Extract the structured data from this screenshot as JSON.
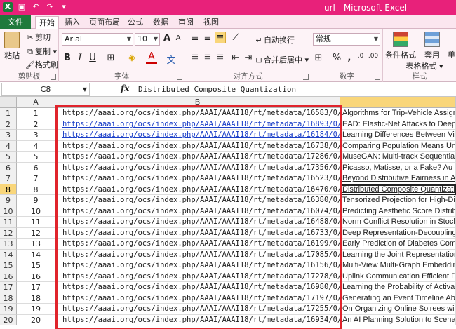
{
  "app": {
    "title": "url - Microsoft Excel",
    "qat": [
      "save-icon",
      "undo-icon",
      "redo-icon"
    ]
  },
  "tabs": [
    "文件",
    "开始",
    "插入",
    "页面布局",
    "公式",
    "数据",
    "审阅",
    "视图"
  ],
  "ribbon": {
    "clipboard": {
      "paste": "粘贴",
      "cut": "剪切",
      "copy": "复制 ▾",
      "format_painter": "格式刷",
      "label": "剪贴板"
    },
    "font": {
      "name": "Arial",
      "size": "10",
      "bold": "B",
      "italic": "I",
      "underline": "U",
      "label": "字体",
      "grow": "A",
      "shrink": "A",
      "phonetic": "文"
    },
    "alignment": {
      "wrap": "自动换行",
      "merge": "合并后居中 ▾",
      "label": "对齐方式"
    },
    "number": {
      "format": "常规",
      "percent": "%",
      "comma": ",",
      "label": "数字"
    },
    "styles": {
      "conditional": "条件格式",
      "table": "套用",
      "table2": "表格格式 ▾",
      "cell": "单",
      "label": "样式"
    }
  },
  "formula_bar": {
    "name_box": "C8",
    "fx": "fx",
    "content": "Distributed Composite Quantization"
  },
  "grid": {
    "columns": [
      "A",
      "B"
    ],
    "selected_row": 8,
    "rows": [
      {
        "n": "1",
        "a": "1",
        "b": "https://aaai.org/ocs/index.php/AAAI/AAAI18/rt/metadata/16583/0/",
        "c": "Algorithms for Trip-Vehicle Assign"
      },
      {
        "n": "2",
        "a": "2",
        "b": "https://aaai.org/ocs/index.php/AAAI/AAAI18/rt/metadata/16893/0/",
        "c": "EAD: Elastic-Net Attacks to Deep"
      },
      {
        "n": "3",
        "a": "3",
        "b": "https://aaai.org/ocs/index.php/AAAI/AAAI18/rt/metadata/16184/0/",
        "c": "Learning Differences Between Vis"
      },
      {
        "n": "4",
        "a": "4",
        "b": "https://aaai.org/ocs/index.php/AAAI/AAAI18/rt/metadata/16738/0/",
        "c": "Comparing Population Means Und"
      },
      {
        "n": "5",
        "a": "5",
        "b": "https://aaai.org/ocs/index.php/AAAI/AAAI18/rt/metadata/17286/0/",
        "c": "MuseGAN: Multi-track Sequential"
      },
      {
        "n": "6",
        "a": "6",
        "b": "https://aaai.org/ocs/index.php/AAAI/AAAI18/rt/metadata/17356/0/",
        "c": "Picasso, Matisse, or a Fake?  Au"
      },
      {
        "n": "7",
        "a": "7",
        "b": "https://aaai.org/ocs/index.php/AAAI/AAAI18/rt/metadata/16523/0/",
        "c": "Beyond Distributive Fairness in Al"
      },
      {
        "n": "8",
        "a": "8",
        "b": "https://aaai.org/ocs/index.php/AAAI/AAAI18/rt/metadata/16470/0/",
        "c": "Distributed Composite Quantizatio"
      },
      {
        "n": "9",
        "a": "9",
        "b": "https://aaai.org/ocs/index.php/AAAI/AAAI18/rt/metadata/16380/0/",
        "c": "Tensorized Projection for High-Dir"
      },
      {
        "n": "10",
        "a": "10",
        "b": "https://aaai.org/ocs/index.php/AAAI/AAAI18/rt/metadata/16074/0/",
        "c": "Predicting Aesthetic Score Distrib"
      },
      {
        "n": "11",
        "a": "11",
        "b": "https://aaai.org/ocs/index.php/AAAI/AAAI18/rt/metadata/16488/0/",
        "c": "Norm Conflict Resolution in Stoch"
      },
      {
        "n": "12",
        "a": "12",
        "b": "https://aaai.org/ocs/index.php/AAAI/AAAI18/rt/metadata/16733/0/",
        "c": "Deep Representation-Decoupling"
      },
      {
        "n": "13",
        "a": "13",
        "b": "https://aaai.org/ocs/index.php/AAAI/AAAI18/rt/metadata/16199/0/",
        "c": "Early Prediction of Diabetes Comp"
      },
      {
        "n": "14",
        "a": "14",
        "b": "https://aaai.org/ocs/index.php/AAAI/AAAI18/rt/metadata/17085/0/",
        "c": "Learning the Joint Representation"
      },
      {
        "n": "15",
        "a": "15",
        "b": "https://aaai.org/ocs/index.php/AAAI/AAAI18/rt/metadata/16156/0/",
        "c": "Multi-View Multi-Graph Embeddin"
      },
      {
        "n": "16",
        "a": "16",
        "b": "https://aaai.org/ocs/index.php/AAAI/AAAI18/rt/metadata/17278/0/",
        "c": "Uplink Communication Efficient Di"
      },
      {
        "n": "17",
        "a": "17",
        "b": "https://aaai.org/ocs/index.php/AAAI/AAAI18/rt/metadata/16980/0/",
        "c": "Learning the Probability of Activat"
      },
      {
        "n": "18",
        "a": "18",
        "b": "https://aaai.org/ocs/index.php/AAAI/AAAI18/rt/metadata/17197/0/",
        "c": "Generating an Event Timeline Abo"
      },
      {
        "n": "19",
        "a": "19",
        "b": "https://aaai.org/ocs/index.php/AAAI/AAAI18/rt/metadata/17255/0/",
        "c": "On Organizing Online Soirees with"
      },
      {
        "n": "20",
        "a": "20",
        "b": "https://aaai.org/ocs/index.php/AAAI/AAAI18/rt/metadata/16934/0/",
        "c": "An AI Planning Solution to Scenar"
      }
    ]
  },
  "colors": {
    "titlebar": "#e8217a",
    "file_tab": "#1f7a3c",
    "highlight_box": "#e0242c",
    "link": "#1a3ec8",
    "selection": "#f9d67a"
  }
}
